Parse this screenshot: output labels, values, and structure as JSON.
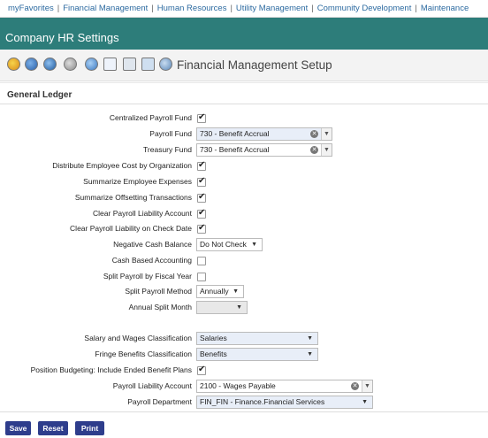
{
  "topnav": {
    "items": [
      "myFavorites",
      "Financial Management",
      "Human Resources",
      "Utility Management",
      "Community Development",
      "Maintenance"
    ],
    "separator": "|"
  },
  "window": {
    "title": "Company HR Settings"
  },
  "toolbar": {
    "icons": [
      "help-icon",
      "wizard-icon",
      "refresh-icon",
      "lock-icon",
      "history-icon",
      "calendar-icon",
      "report-icon",
      "book-icon",
      "settings-icon"
    ],
    "heading": "Financial Management Setup"
  },
  "general_ledger": {
    "section_title": "General Ledger",
    "centralized_payroll_fund": {
      "label": "Centralized Payroll Fund",
      "checked": true
    },
    "payroll_fund": {
      "label": "Payroll Fund",
      "value": "730 - Benefit Accrual"
    },
    "treasury_fund": {
      "label": "Treasury Fund",
      "value": "730 - Benefit Accrual"
    },
    "distribute_cost": {
      "label": "Distribute Employee Cost by Organization",
      "checked": true
    },
    "summarize_expenses": {
      "label": "Summarize Employee Expenses",
      "checked": true
    },
    "summarize_offsetting": {
      "label": "Summarize Offsetting Transactions",
      "checked": true
    },
    "clear_liability_account": {
      "label": "Clear Payroll Liability Account",
      "checked": true
    },
    "clear_liability_check_date": {
      "label": "Clear Payroll Liability on Check Date",
      "checked": true
    },
    "negative_cash_balance": {
      "label": "Negative Cash Balance",
      "value": "Do Not Check"
    },
    "cash_based_accounting": {
      "label": "Cash Based Accounting",
      "checked": false
    },
    "split_fiscal_year": {
      "label": "Split Payroll by Fiscal Year",
      "checked": false
    },
    "split_payroll_method": {
      "label": "Split Payroll Method",
      "value": "Annually"
    },
    "annual_split_month": {
      "label": "Annual Split Month",
      "value": ""
    },
    "salary_classification": {
      "label": "Salary and Wages Classification",
      "value": "Salaries"
    },
    "fringe_classification": {
      "label": "Fringe Benefits Classification",
      "value": "Benefits"
    },
    "position_budgeting": {
      "label": "Position Budgeting: Include Ended Benefit Plans",
      "checked": true
    },
    "payroll_liability_account": {
      "label": "Payroll Liability Account",
      "value": "2100 - Wages Payable"
    },
    "payroll_department": {
      "label": "Payroll Department",
      "value": "FIN_FIN - Finance.Financial Services"
    }
  },
  "actions": {
    "save": "Save",
    "reset": "Reset",
    "print": "Print"
  }
}
